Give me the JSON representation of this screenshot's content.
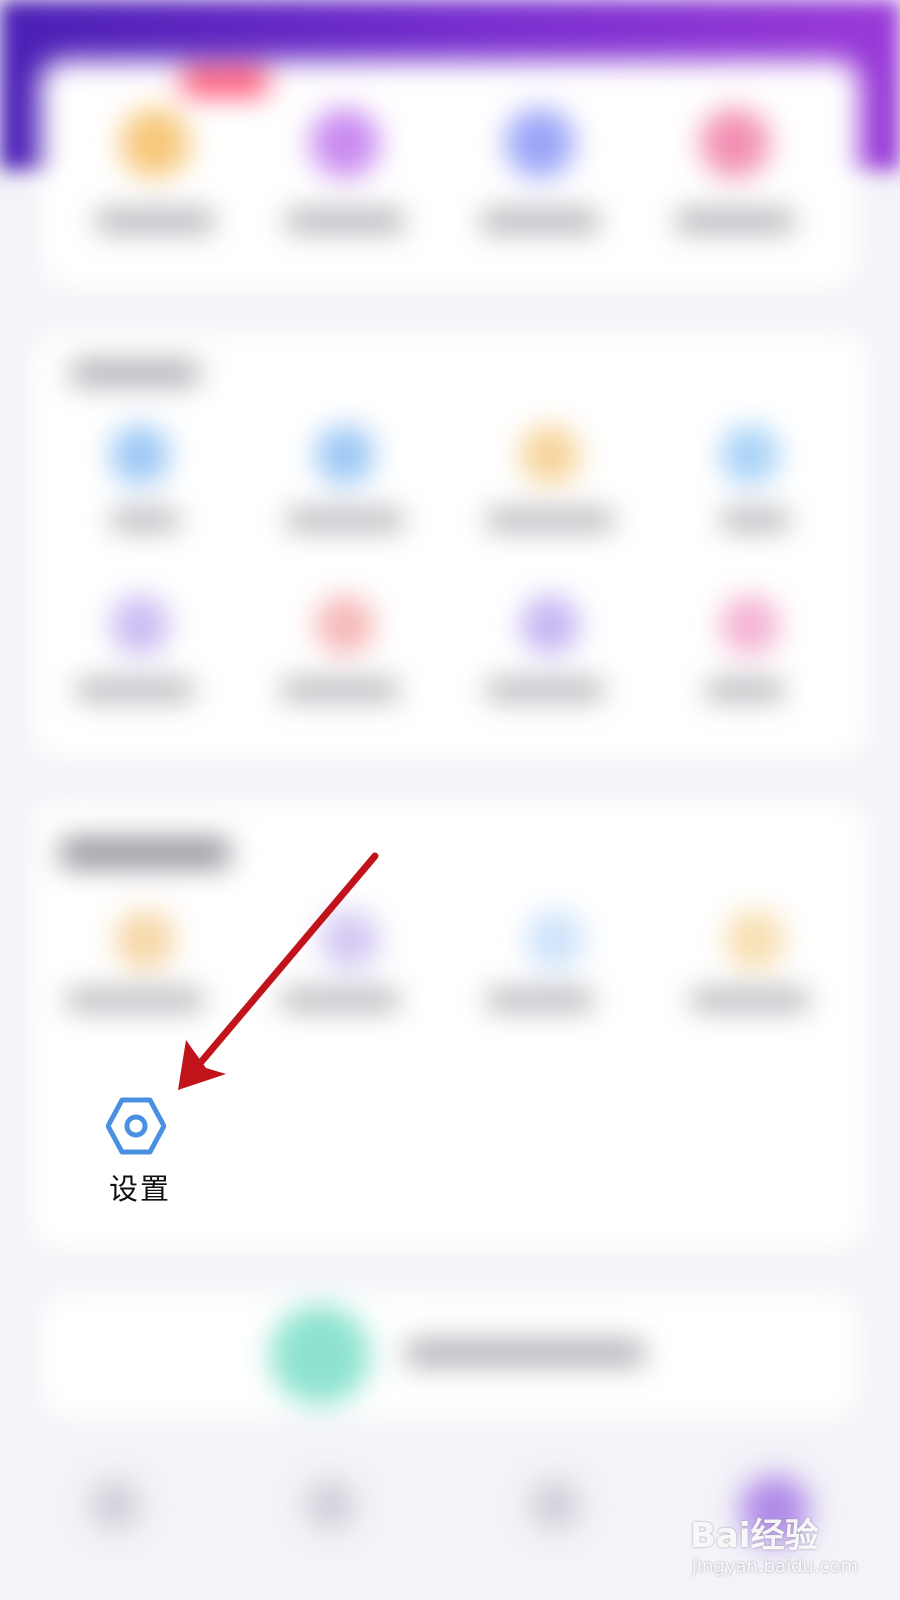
{
  "settings": {
    "label": "设置",
    "icon": "hexagon-gear-icon",
    "icon_color": "#4a90e2"
  },
  "annotation": {
    "arrow_color": "#c0141a"
  },
  "watermark": {
    "main": "Bai经验",
    "sub": "jingyan.baidu.com"
  },
  "colors": {
    "header_gradient": [
      "#4a1fb5",
      "#9a3ad8"
    ],
    "background": "#f3f3f8"
  }
}
